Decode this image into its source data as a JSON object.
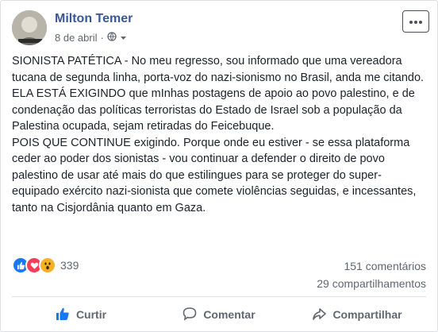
{
  "post": {
    "author": "Milton Temer",
    "date": "8 de abril",
    "paragraphs": [
      "SIONISTA PATÉTICA - No meu regresso, sou informado que uma vereadora tucana de segunda linha, porta-voz do nazi-sionismo no Brasil, anda me citando.",
      "ELA ESTÁ EXIGINDO que mInhas postagens de apoio ao povo palestino, e de condenação das políticas terroristas do Estado de Israel sob a população da Palestina ocupada, sejam retiradas do Feicebuque.",
      "POIS QUE CONTINUE exigindo. Porque onde eu estiver - se essa plataforma ceder ao poder dos sionistas - vou continuar a defender o direito de povo palestino de usar até mais do que estilingues para se proteger do super-equipado exército nazi-sionista que comete violências seguidas, e incessantes, tanto na Cisjordânia quanto em Gaza."
    ],
    "reactions_count": "339",
    "comments": "151 comentários",
    "shares": "29 compartilhamentos"
  },
  "actions": {
    "like": "Curtir",
    "comment": "Comentar",
    "share": "Compartilhar"
  },
  "icons": {
    "privacy": "globe-icon",
    "audience_menu": "chevron-down-icon",
    "more": "more-options-icon",
    "like_reaction": "like-reaction-icon",
    "love_reaction": "love-reaction-icon",
    "wow_reaction": "wow-reaction-icon"
  },
  "colors": {
    "author": "#385898",
    "like_blue": "#1877f2",
    "love_red": "#f33e58",
    "wow_yellow": "#f7b125"
  }
}
